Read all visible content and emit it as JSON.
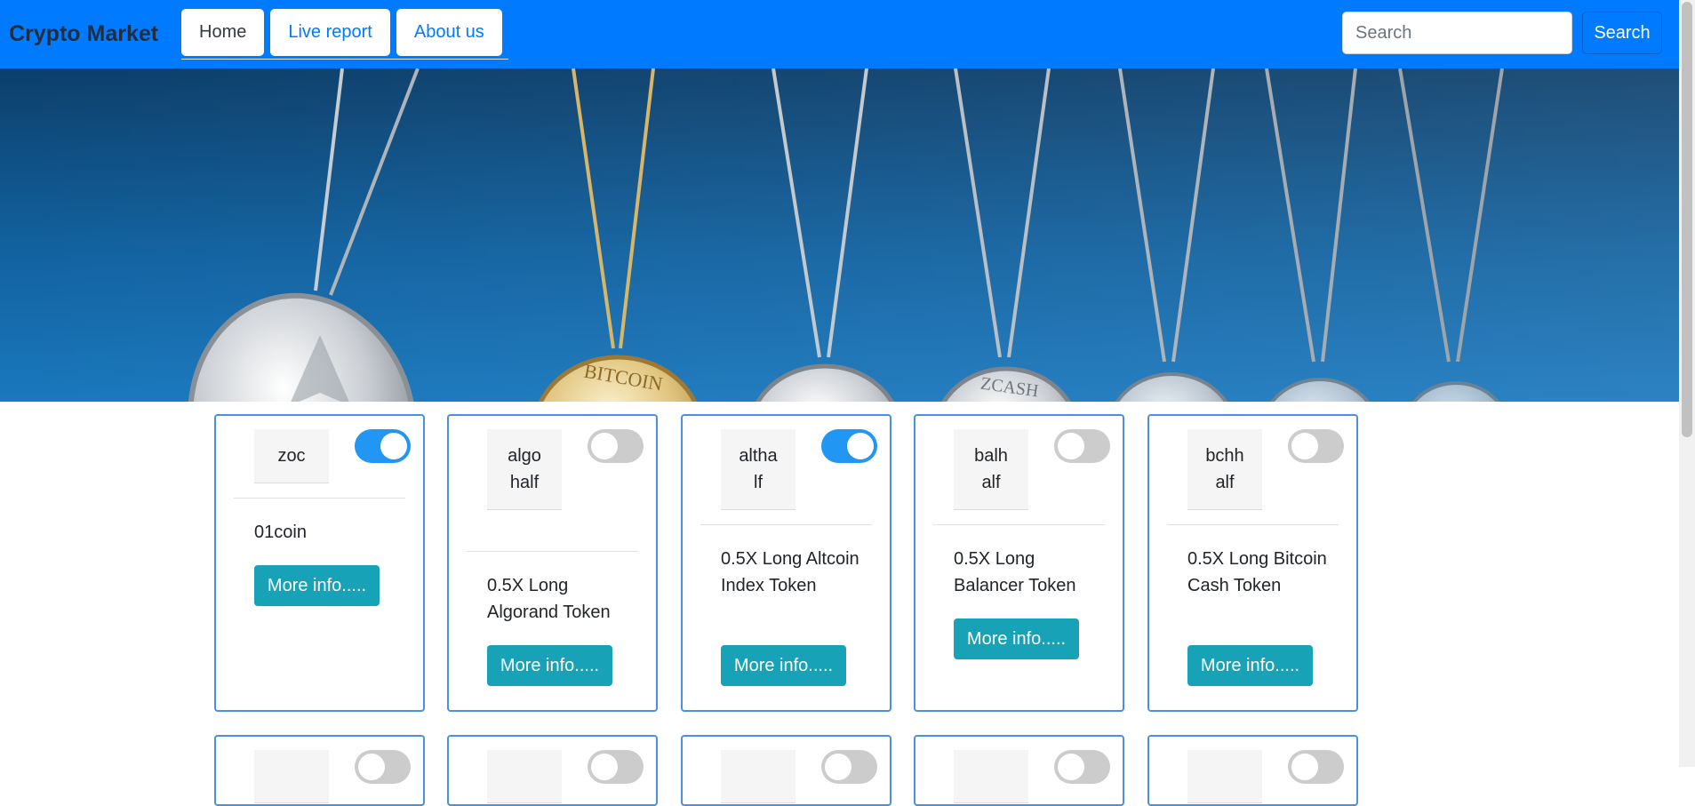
{
  "navbar": {
    "brand": "Crypto Market",
    "tabs": [
      {
        "label": "Home",
        "active": true
      },
      {
        "label": "Live report",
        "active": false
      },
      {
        "label": "About us",
        "active": false
      }
    ],
    "search_placeholder": "Search",
    "search_button": "Search"
  },
  "hero": {
    "coin_labels": [
      "BITCOIN",
      "ZCASH"
    ]
  },
  "cards": [
    {
      "symbol": "zoc",
      "toggled": true,
      "name": "01coin",
      "button": "More info....."
    },
    {
      "symbol": "algohalf",
      "toggled": false,
      "name": "0.5X Long Algorand Token",
      "button": "More info....."
    },
    {
      "symbol": "althalf",
      "toggled": true,
      "name": "0.5X Long Altcoin Index Token",
      "button": "More info....."
    },
    {
      "symbol": "balhalf",
      "toggled": false,
      "name": "0.5X Long Balancer Token",
      "button": "More info....."
    },
    {
      "symbol": "bchhalf",
      "toggled": false,
      "name": "0.5X Long Bitcoin Cash Token",
      "button": "More info....."
    }
  ],
  "colors": {
    "navbar": "#007bff",
    "toggle_on": "#2196f3",
    "info_button": "#17a2b8",
    "card_border": "#4a90e2"
  }
}
